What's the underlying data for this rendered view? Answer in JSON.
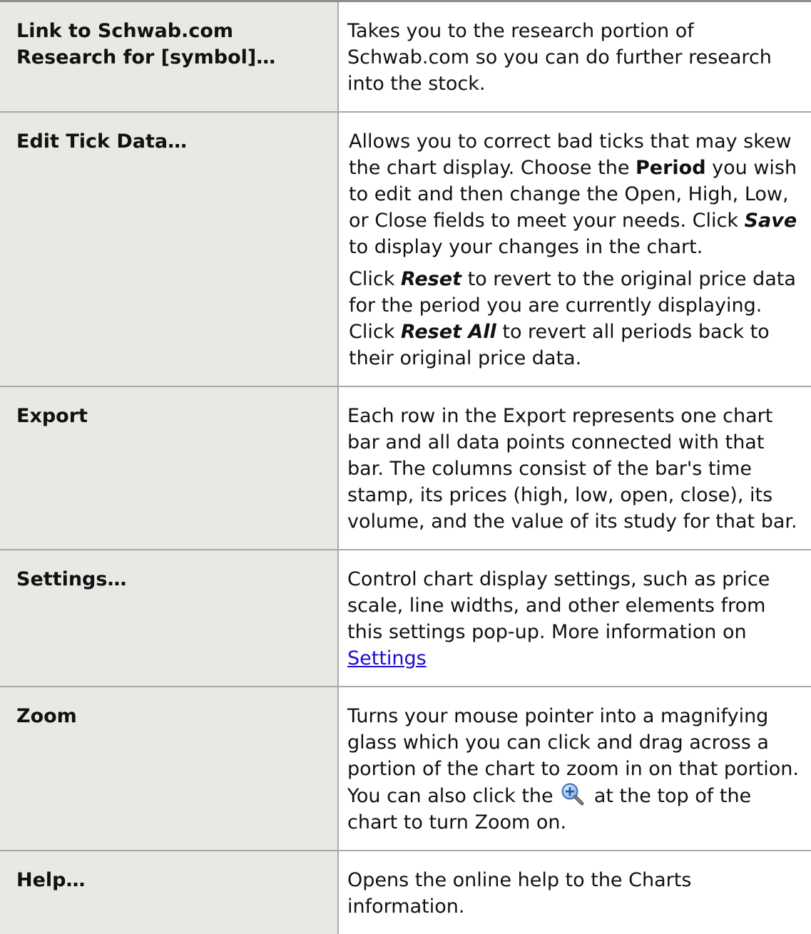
{
  "rows": [
    {
      "term": "Link to Schwab.com Research for [symbol]…",
      "desc": "Takes you to the research portion of Schwab.com so you can do further research into the stock."
    },
    {
      "term": "Edit Tick Data…",
      "p1_a": "Allows you to correct bad ticks that may skew the chart display. Choose the ",
      "p1_b": "Period",
      "p1_c": " you wish to edit and then change the Open, High, Low, or Close fields to meet your needs. Click ",
      "p1_d": "Save",
      "p1_e": " to display your changes in the chart.",
      "p2_a": "Click ",
      "p2_b": "Reset",
      "p2_c": " to revert to the original price data for the period you are currently displaying. Click ",
      "p2_d": "Reset All",
      "p2_e": " to revert all periods back to their original price data."
    },
    {
      "term": "Export",
      "desc": "Each row in the Export represents one chart bar and all data points connected with that bar. The columns consist of the bar's time stamp, its prices (high, low, open, close), its volume, and the value of its study for that bar."
    },
    {
      "term": "Settings…",
      "desc": "Control chart display settings, such as price scale, line widths, and other elements from this settings pop-up. More information on ",
      "link": "Settings"
    },
    {
      "term": "Zoom",
      "desc_a": "Turns your mouse pointer into a magnifying glass which you can click and drag across a portion of the chart to zoom in on that portion. You can also click the ",
      "icon": "zoom-in-magnifier-icon",
      "desc_b": " at the top of the chart to turn Zoom on."
    },
    {
      "term": "Help…",
      "desc": "Opens the online help to the Charts information."
    }
  ],
  "colors": {
    "term_background": "#e9e8e5",
    "border": "#a8a8a8",
    "link": "#1a0dcc"
  }
}
